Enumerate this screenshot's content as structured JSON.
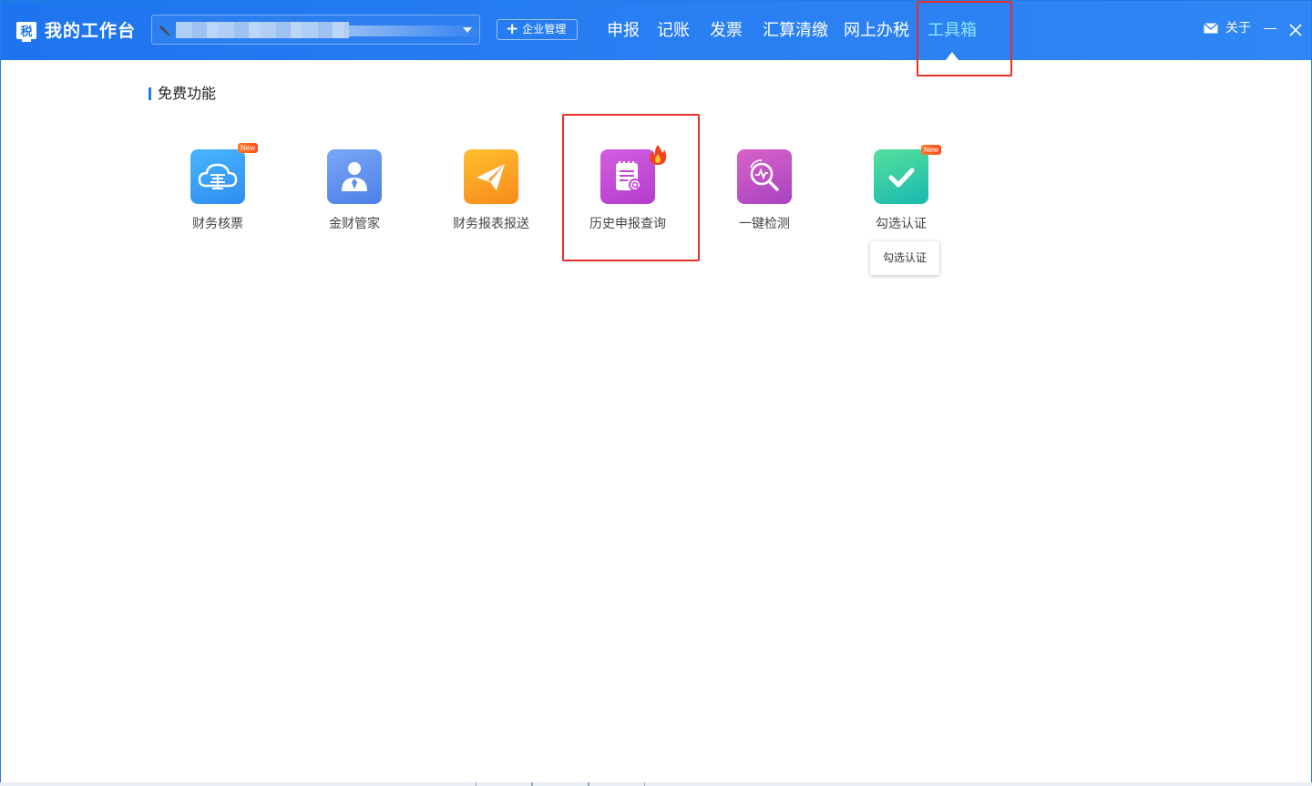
{
  "app": {
    "title": "我的工作台",
    "logo_glyph": "税"
  },
  "company_select": {
    "value": "",
    "pin_icon": "pin-icon"
  },
  "enterprise_button": {
    "label": "企业管理",
    "icon": "plus-icon"
  },
  "nav": {
    "items": [
      {
        "label": "申报"
      },
      {
        "label": "记账"
      },
      {
        "label": "发票"
      },
      {
        "label": "汇算清缴"
      },
      {
        "label": "网上办税"
      },
      {
        "label": "工具箱"
      }
    ],
    "active_index": 5
  },
  "window_controls": {
    "about_label": "关于",
    "mail_icon": "mail-icon",
    "minimize_icon": "minimize-icon",
    "close_icon": "close-icon"
  },
  "section": {
    "title": "免费功能"
  },
  "tools": [
    {
      "label": "财务核票",
      "icon": "invoice-cloud-icon",
      "badge": "New",
      "color": "#3aa1f5"
    },
    {
      "label": "金财管家",
      "icon": "steward-person-icon",
      "badge": "",
      "color": "#5a8ff0"
    },
    {
      "label": "财务报表报送",
      "icon": "paper-plane-icon",
      "badge": "",
      "color": "#fb9a22"
    },
    {
      "label": "历史申报查询",
      "icon": "history-search-icon",
      "badge": "hot",
      "color": "#c446d6"
    },
    {
      "label": "一键检测",
      "icon": "detect-magnifier-icon",
      "badge": "",
      "color": "#c24fc4"
    },
    {
      "label": "勾选认证",
      "icon": "check-icon",
      "badge": "New",
      "color": "#2cc9a6"
    }
  ],
  "tooltip": {
    "text": "勾选认证"
  },
  "colors": {
    "topbar": "#2a7ff2",
    "active_nav": "#8fe6ff",
    "highlight": "#e8302a",
    "section_accent": "#1f7de6"
  }
}
